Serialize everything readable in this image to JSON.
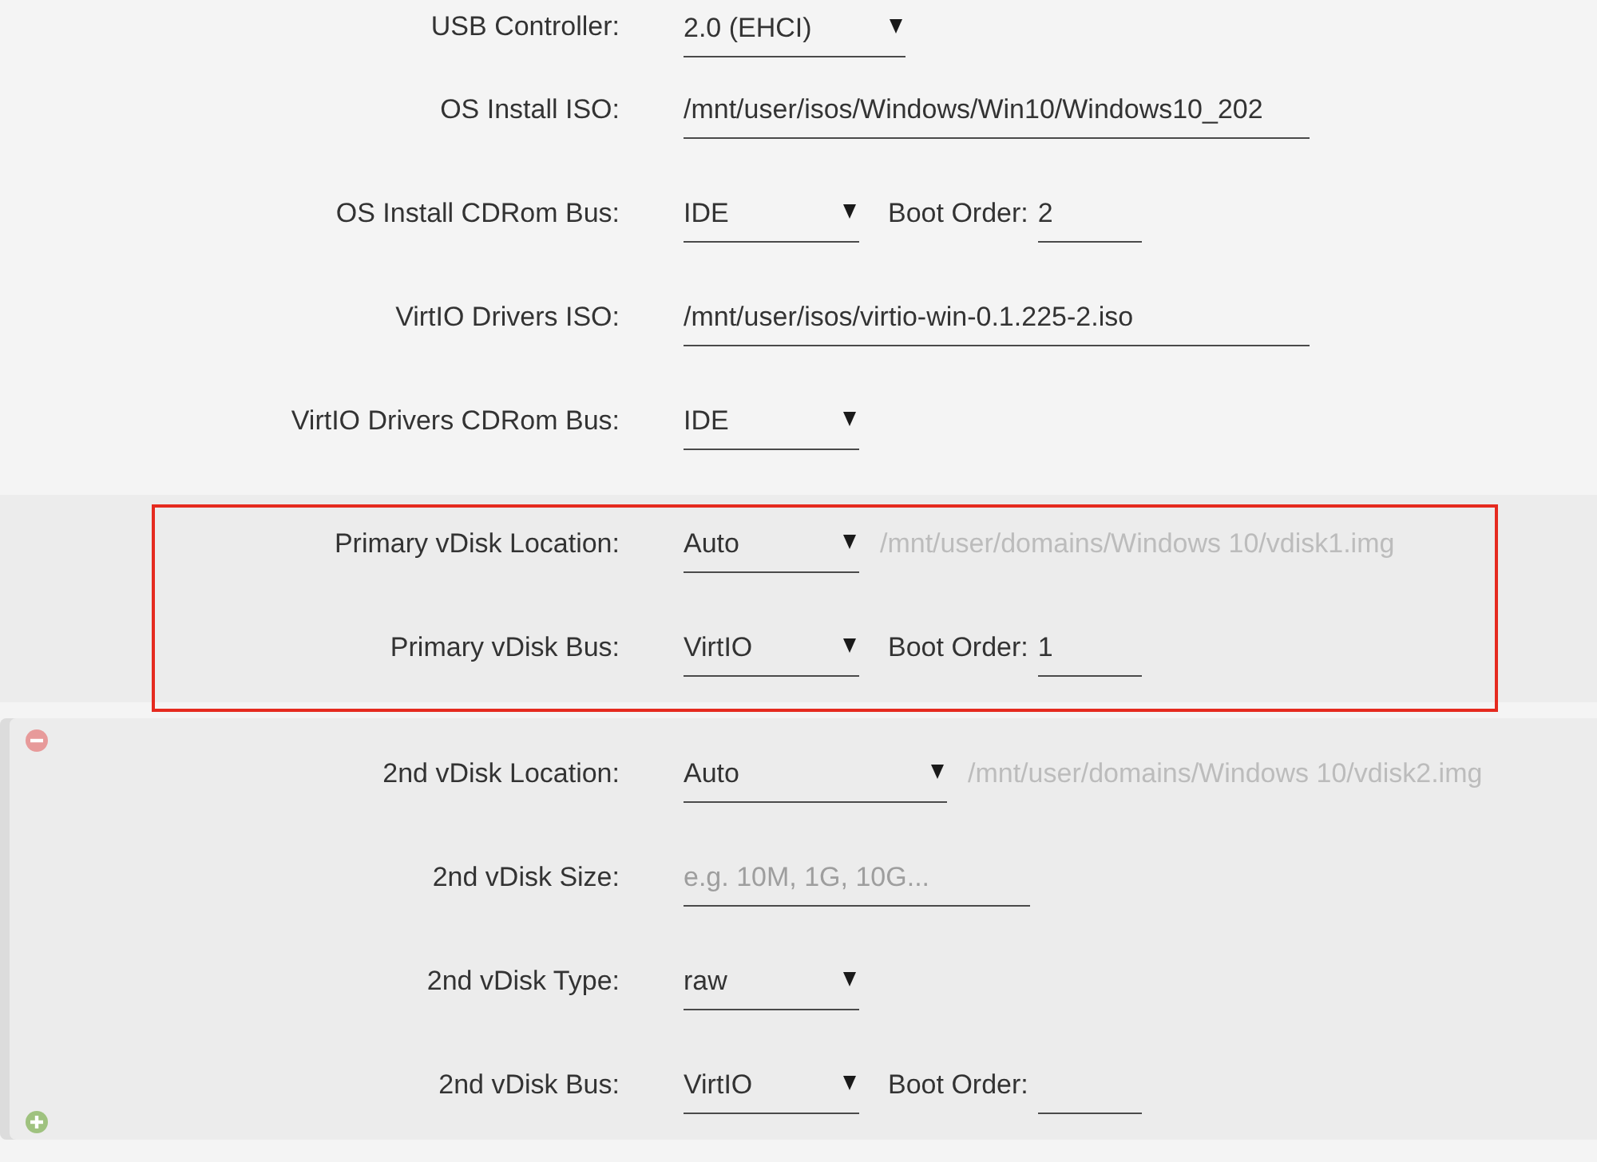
{
  "sections": [
    {
      "kind": "plain",
      "highlighted": false,
      "rows": [
        {
          "label": "USB Controller:",
          "field": {
            "kind": "select",
            "value": "2.0 (EHCI)"
          }
        },
        {
          "label": "OS Install ISO:",
          "field": {
            "kind": "text",
            "value": "/mnt/user/isos/Windows/Win10/Windows10_202"
          }
        },
        {
          "label": "OS Install CDRom Bus:",
          "field": {
            "kind": "select",
            "value": "IDE"
          },
          "boot_order": {
            "label": "Boot Order:",
            "value": "2"
          }
        },
        {
          "label": "VirtIO Drivers ISO:",
          "field": {
            "kind": "text",
            "value": "/mnt/user/isos/virtio-win-0.1.225-2.iso"
          }
        },
        {
          "label": "VirtIO Drivers CDRom Bus:",
          "field": {
            "kind": "select",
            "value": "IDE"
          }
        }
      ]
    },
    {
      "kind": "disk",
      "highlighted": true,
      "rows": [
        {
          "label": "Primary vDisk Location:",
          "field": {
            "kind": "select",
            "value": "Auto"
          },
          "path": "/mnt/user/domains/Windows 10/vdisk1.img"
        },
        {
          "label": "Primary vDisk Bus:",
          "field": {
            "kind": "select",
            "value": "VirtIO"
          },
          "boot_order": {
            "label": "Boot Order:",
            "value": "1"
          }
        }
      ]
    },
    {
      "kind": "extra_disk",
      "highlighted": false,
      "rows": [
        {
          "label": "2nd vDisk Location:",
          "field": {
            "kind": "select",
            "value": "Auto"
          },
          "path": "/mnt/user/domains/Windows 10/vdisk2.img"
        },
        {
          "label": "2nd vDisk Size:",
          "field": {
            "kind": "text",
            "placeholder": "e.g. 10M, 1G, 10G..."
          }
        },
        {
          "label": "2nd vDisk Type:",
          "field": {
            "kind": "select",
            "value": "raw"
          }
        },
        {
          "label": "2nd vDisk Bus:",
          "field": {
            "kind": "select",
            "value": "VirtIO"
          },
          "boot_order": {
            "label": "Boot Order:"
          }
        }
      ]
    }
  ]
}
